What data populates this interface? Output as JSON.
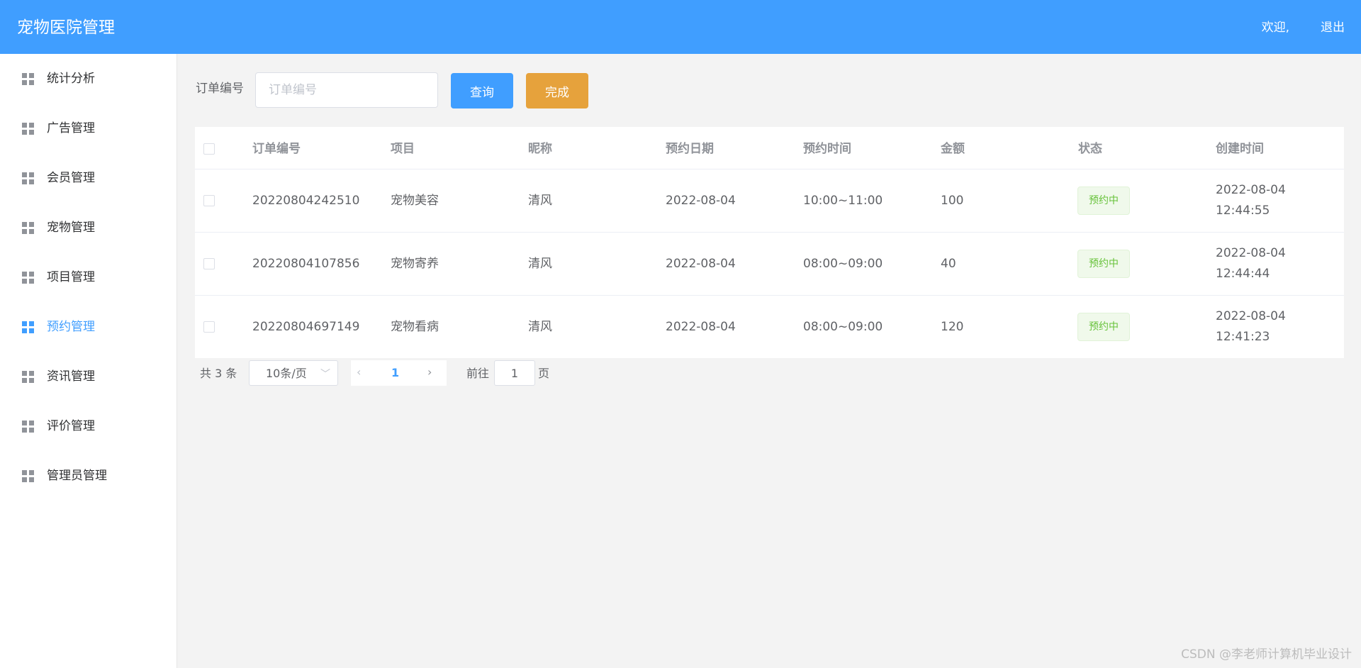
{
  "header": {
    "title": "宠物医院管理",
    "welcome": "欢迎,",
    "logout": "退出"
  },
  "sidebar": {
    "items": [
      {
        "label": "统计分析",
        "icon": "grid-icon",
        "active": false
      },
      {
        "label": "广告管理",
        "icon": "grid-icon",
        "active": false
      },
      {
        "label": "会员管理",
        "icon": "grid-icon",
        "active": false
      },
      {
        "label": "宠物管理",
        "icon": "grid-icon",
        "active": false
      },
      {
        "label": "项目管理",
        "icon": "grid-icon",
        "active": false
      },
      {
        "label": "预约管理",
        "icon": "grid-icon",
        "active": true
      },
      {
        "label": "资讯管理",
        "icon": "grid-icon",
        "active": false
      },
      {
        "label": "评价管理",
        "icon": "grid-icon",
        "active": false
      },
      {
        "label": "管理员管理",
        "icon": "grid-icon",
        "active": false
      }
    ]
  },
  "search": {
    "label": "订单编号",
    "placeholder": "订单编号",
    "value": "",
    "query_button": "查询",
    "done_button": "完成"
  },
  "table": {
    "headers": [
      "订单编号",
      "项目",
      "昵称",
      "预约日期",
      "预约时间",
      "金额",
      "状态",
      "创建时间"
    ],
    "rows": [
      {
        "order_no": "20220804242510",
        "project": "宠物美容",
        "nickname": "清风",
        "date": "2022-08-04",
        "time": "10:00~11:00",
        "amount": "100",
        "status": "预约中",
        "created": "2022-08-04 12:44:55"
      },
      {
        "order_no": "20220804107856",
        "project": "宠物寄养",
        "nickname": "清风",
        "date": "2022-08-04",
        "time": "08:00~09:00",
        "amount": "40",
        "status": "预约中",
        "created": "2022-08-04 12:44:44"
      },
      {
        "order_no": "20220804697149",
        "project": "宠物看病",
        "nickname": "清风",
        "date": "2022-08-04",
        "time": "08:00~09:00",
        "amount": "120",
        "status": "预约中",
        "created": "2022-08-04 12:41:23"
      }
    ]
  },
  "pagination": {
    "total_text": "共 3 条",
    "page_size": "10条/页",
    "current_page": "1",
    "goto_label": "前往",
    "goto_value": "1",
    "page_suffix": "页"
  },
  "watermark": "CSDN @李老师计算机毕业设计",
  "colors": {
    "primary": "#409eff",
    "warning": "#e6a23c",
    "success": "#67c23a"
  }
}
